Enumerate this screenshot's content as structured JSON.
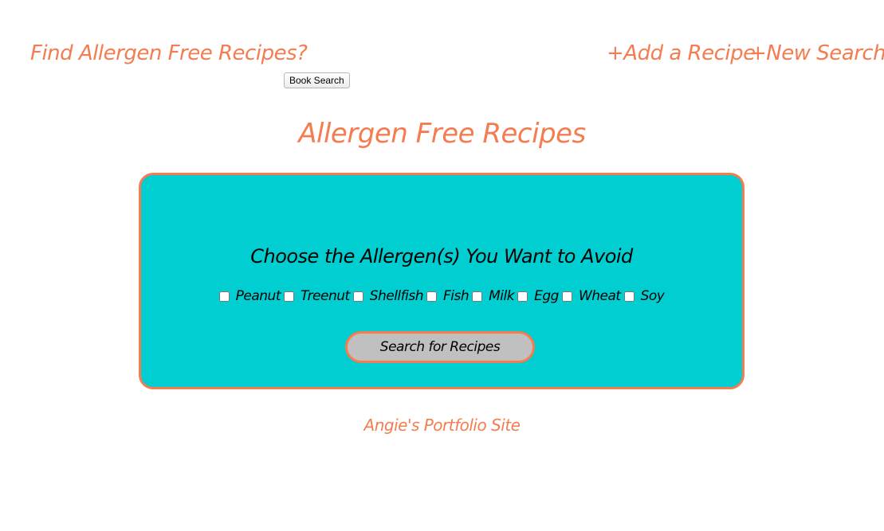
{
  "nav": {
    "brand": "Find Allergen Free Recipes?",
    "add_recipe": "+Add a Recipe",
    "new_search": "+New Search",
    "book_search": "Book Search"
  },
  "main": {
    "title": "Allergen Free Recipes",
    "panel_heading": "Choose the Allergen(s) You Want to Avoid",
    "allergens": [
      "Peanut",
      "Treenut",
      "Shellfish",
      "Fish",
      "Milk",
      "Egg",
      "Wheat",
      "Soy"
    ],
    "search_button": "Search for Recipes"
  },
  "footer": {
    "portfolio_link": "Angie's Portfolio Site"
  },
  "colors": {
    "accent": "#f47c50",
    "panel_bg": "#00ced1",
    "button_bg": "#c0c0c0"
  }
}
